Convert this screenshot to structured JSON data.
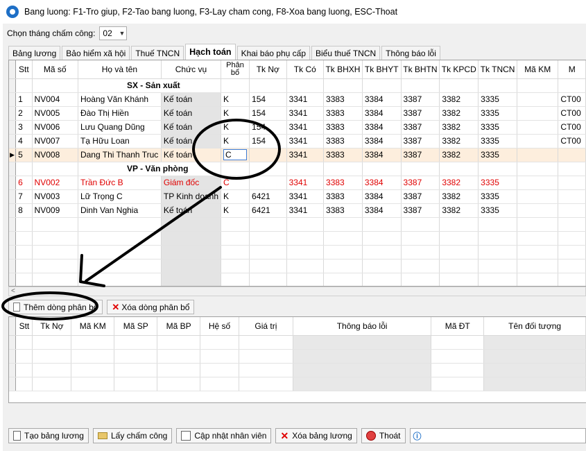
{
  "window": {
    "title": "Bang luong: F1-Tro giup, F2-Tao bang luong, F3-Lay cham cong, F8-Xoa bang luong, ESC-Thoat"
  },
  "month": {
    "label": "Chọn tháng chấm công:",
    "value": "02"
  },
  "tabs": [
    {
      "label": "Bảng lương"
    },
    {
      "label": "Bảo hiểm xã hội"
    },
    {
      "label": "Thuế TNCN"
    },
    {
      "label": "Hạch toán"
    },
    {
      "label": "Khai báo phụ cấp"
    },
    {
      "label": "Biểu thuế TNCN"
    },
    {
      "label": "Thông báo lỗi"
    }
  ],
  "top_grid": {
    "columns": [
      "Stt",
      "Mã số",
      "Họ và tên",
      "Chức vụ",
      "Phân bổ",
      "Tk Nợ",
      "Tk Có",
      "Tk BHXH",
      "Tk BHYT",
      "Tk BHTN",
      "Tk KPCD",
      "Tk TNCN",
      "Mã KM",
      "M"
    ],
    "rows": [
      {
        "group": "SX - Sản xuất"
      },
      {
        "stt": "1",
        "ma": "NV004",
        "ten": "Hoàng Văn Khánh",
        "cv": "Kế toán",
        "pb": "K",
        "no": "154",
        "co": "3341",
        "bhxh": "3383",
        "bhyt": "3384",
        "bhtn": "3387",
        "kpcd": "3382",
        "tncn": "3335",
        "km": "",
        "m": "CT00"
      },
      {
        "stt": "2",
        "ma": "NV005",
        "ten": "Đào Thị Hiền",
        "cv": "Kế toán",
        "pb": "K",
        "no": "154",
        "co": "3341",
        "bhxh": "3383",
        "bhyt": "3384",
        "bhtn": "3387",
        "kpcd": "3382",
        "tncn": "3335",
        "km": "",
        "m": "CT00"
      },
      {
        "stt": "3",
        "ma": "NV006",
        "ten": "Lưu Quang Dũng",
        "cv": "Kế toán",
        "pb": "K",
        "no": "154",
        "co": "3341",
        "bhxh": "3383",
        "bhyt": "3384",
        "bhtn": "3387",
        "kpcd": "3382",
        "tncn": "3335",
        "km": "",
        "m": "CT00"
      },
      {
        "stt": "4",
        "ma": "NV007",
        "ten": "Tạ Hữu Loan",
        "cv": "Kế toán",
        "pb": "K",
        "no": "154",
        "co": "3341",
        "bhxh": "3383",
        "bhyt": "3384",
        "bhtn": "3387",
        "kpcd": "3382",
        "tncn": "3335",
        "km": "",
        "m": "CT00"
      },
      {
        "stt": "5",
        "ma": "NV008",
        "ten": "Dang Thi Thanh Truc",
        "cv": "Kế toán",
        "pb": "C",
        "no": "",
        "co": "3341",
        "bhxh": "3383",
        "bhyt": "3384",
        "bhtn": "3387",
        "kpcd": "3382",
        "tncn": "3335",
        "km": "",
        "m": ""
      },
      {
        "group": "VP - Văn phòng"
      },
      {
        "stt": "6",
        "ma": "NV002",
        "ten": "Trần Đức B",
        "cv": "Giám đốc",
        "pb": "C",
        "no": "",
        "co": "3341",
        "bhxh": "3383",
        "bhyt": "3384",
        "bhtn": "3387",
        "kpcd": "3382",
        "tncn": "3335",
        "km": "",
        "m": ""
      },
      {
        "stt": "7",
        "ma": "NV003",
        "ten": "Lữ Trọng C",
        "cv": "TP Kinh doanh",
        "pb": "K",
        "no": "6421",
        "co": "3341",
        "bhxh": "3383",
        "bhyt": "3384",
        "bhtn": "3387",
        "kpcd": "3382",
        "tncn": "3335",
        "km": "",
        "m": ""
      },
      {
        "stt": "8",
        "ma": "NV009",
        "ten": "Dinh Van Nghia",
        "cv": "Kế toán",
        "pb": "K",
        "no": "6421",
        "co": "3341",
        "bhxh": "3383",
        "bhyt": "3384",
        "bhtn": "3387",
        "kpcd": "3382",
        "tncn": "3335",
        "km": "",
        "m": ""
      }
    ],
    "selected_row": 5,
    "red_row": 6
  },
  "scroll_left_glyph": "<",
  "alloc_buttons": {
    "add": "Thêm dòng phân bổ",
    "delete": "Xóa dòng phân bổ"
  },
  "bottom_grid": {
    "columns": [
      "Stt",
      "Tk Nợ",
      "Mã KM",
      "Mã SP",
      "Mã BP",
      "Hệ số",
      "Giá trị",
      "Thông báo lỗi",
      "Mã ĐT",
      "Tên đối tượng"
    ]
  },
  "toolbar": {
    "create": "Tạo bảng lương",
    "fetch": "Lấy chấm công",
    "update": "Cập nhật nhân viên",
    "delete": "Xóa bảng lương",
    "exit": "Thoát"
  },
  "colors": {
    "red_text": "#e00000",
    "selected_row": "#fdeedd",
    "accent": "#1e6fc6"
  }
}
